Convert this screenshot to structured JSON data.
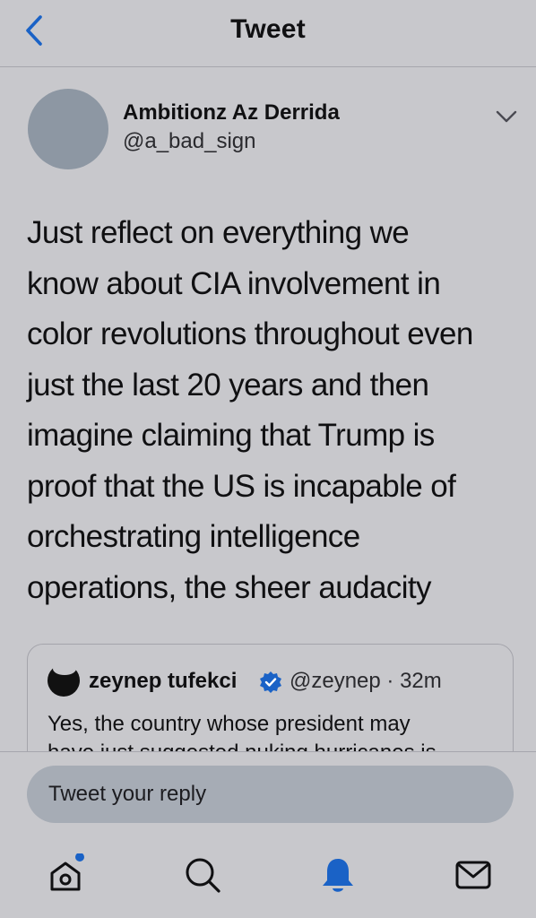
{
  "header": {
    "title": "Tweet",
    "back_icon": "chevron-left-icon"
  },
  "tweet": {
    "author": {
      "name": "Ambitionz Az Derrida",
      "handle": "@a_bad_sign"
    },
    "menu_icon": "chevron-down-icon",
    "body_lines": [
      "Just reflect on everything we",
      "know about CIA involvement in",
      "color revolutions throughout even",
      "just the last 20 years and then",
      "imagine claiming that Trump is",
      "proof that the US is incapable of",
      "orchestrating intelligence",
      "operations, the sheer audacity"
    ]
  },
  "quoted_tweet": {
    "name": "zeynep tufekci",
    "handle_time": "@zeynep · 32m",
    "verified_icon": "verified-badge-icon",
    "text_lines": [
      "Yes, the country whose president may",
      "have just suggested nuking hurricanes is"
    ]
  },
  "reply": {
    "placeholder": "Tweet your reply"
  },
  "tabbar": {
    "items": [
      {
        "name": "home",
        "icon": "home-icon",
        "active": false,
        "has_dot": true
      },
      {
        "name": "search",
        "icon": "search-icon",
        "active": false
      },
      {
        "name": "notifications",
        "icon": "bell-icon",
        "active": true
      },
      {
        "name": "messages",
        "icon": "mail-icon",
        "active": false
      }
    ]
  },
  "colors": {
    "accent": "#1a62c6",
    "background": "#c8c8cc",
    "input_bg": "#a6acb5"
  }
}
